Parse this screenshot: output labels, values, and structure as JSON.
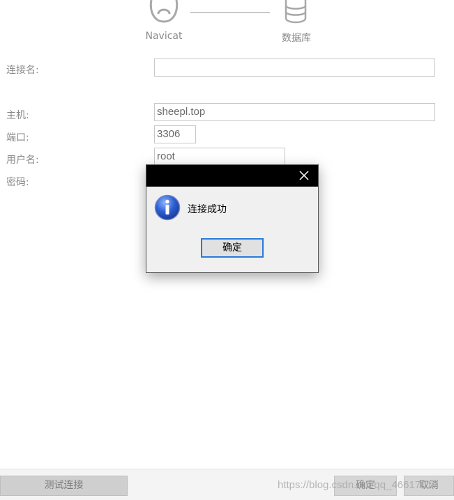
{
  "header": {
    "navicat_label": "Navicat",
    "database_label": "数据库"
  },
  "form": {
    "connection_name": {
      "label": "连接名:",
      "value": ""
    },
    "host": {
      "label": "主机:",
      "value": "sheepl.top"
    },
    "port": {
      "label": "端口:",
      "value": "3306"
    },
    "username": {
      "label": "用户名:",
      "value": "root"
    },
    "password": {
      "label": "密码:"
    }
  },
  "dialog": {
    "message": "连接成功",
    "ok_label": "确定"
  },
  "footer": {
    "test_connection_label": "测试连接",
    "confirm_label": "确定",
    "cancel_label": "取消"
  },
  "watermark": "https://blog.csdn.net/qq_46617017"
}
